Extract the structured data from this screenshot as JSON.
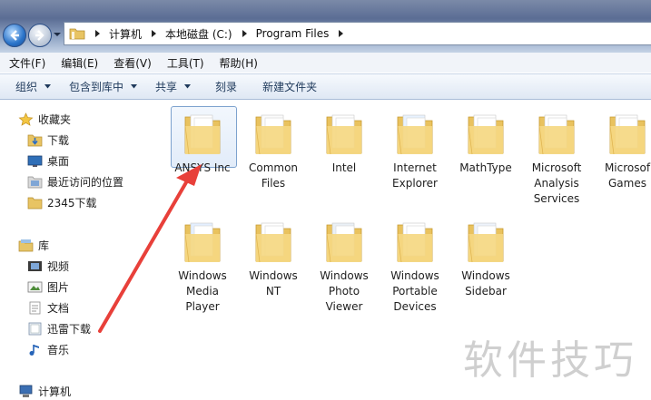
{
  "address": {
    "crumbs": [
      "计算机",
      "本地磁盘 (C:)",
      "Program Files"
    ]
  },
  "menu": [
    "文件(F)",
    "编辑(E)",
    "查看(V)",
    "工具(T)",
    "帮助(H)"
  ],
  "toolbar": {
    "organize": "组织",
    "include_library": "包含到库中",
    "share": "共享",
    "burn": "刻录",
    "new_folder": "新建文件夹"
  },
  "nav": {
    "favorites_header": "收藏夹",
    "favorites": [
      {
        "label": "下载",
        "icon": "download-folder-icon"
      },
      {
        "label": "桌面",
        "icon": "desktop-icon"
      },
      {
        "label": "最近访问的位置",
        "icon": "recent-places-icon"
      },
      {
        "label": "2345下载",
        "icon": "folder-icon"
      }
    ],
    "libraries_header": "库",
    "libraries": [
      {
        "label": "视频",
        "icon": "video-library-icon"
      },
      {
        "label": "图片",
        "icon": "pictures-library-icon"
      },
      {
        "label": "文档",
        "icon": "documents-library-icon"
      },
      {
        "label": "迅雷下载",
        "icon": "xunlei-download-icon"
      },
      {
        "label": "音乐",
        "icon": "music-library-icon"
      }
    ],
    "computer_header": "计算机"
  },
  "items": [
    {
      "lines": [
        "ANSYS Inc"
      ],
      "selected": true
    },
    {
      "lines": [
        "Common",
        "Files"
      ]
    },
    {
      "lines": [
        "Intel"
      ]
    },
    {
      "lines": [
        "Internet",
        "Explorer"
      ]
    },
    {
      "lines": [
        "MathType"
      ]
    },
    {
      "lines": [
        "Microsoft",
        "Analysis",
        "Services"
      ]
    },
    {
      "lines": [
        "Microsof",
        "Games"
      ]
    },
    {
      "lines": [
        "Windows",
        "Media",
        "Player"
      ]
    },
    {
      "lines": [
        "Windows",
        "NT"
      ]
    },
    {
      "lines": [
        "Windows",
        "Photo",
        "Viewer"
      ]
    },
    {
      "lines": [
        "Windows",
        "Portable",
        "Devices"
      ]
    },
    {
      "lines": [
        "Windows",
        "Sidebar"
      ]
    }
  ],
  "watermark": "软件技巧",
  "colors": {
    "annotation_arrow": "#e8403a",
    "folder_yellow": "#f2d276",
    "selection_border": "#7da2ce"
  }
}
